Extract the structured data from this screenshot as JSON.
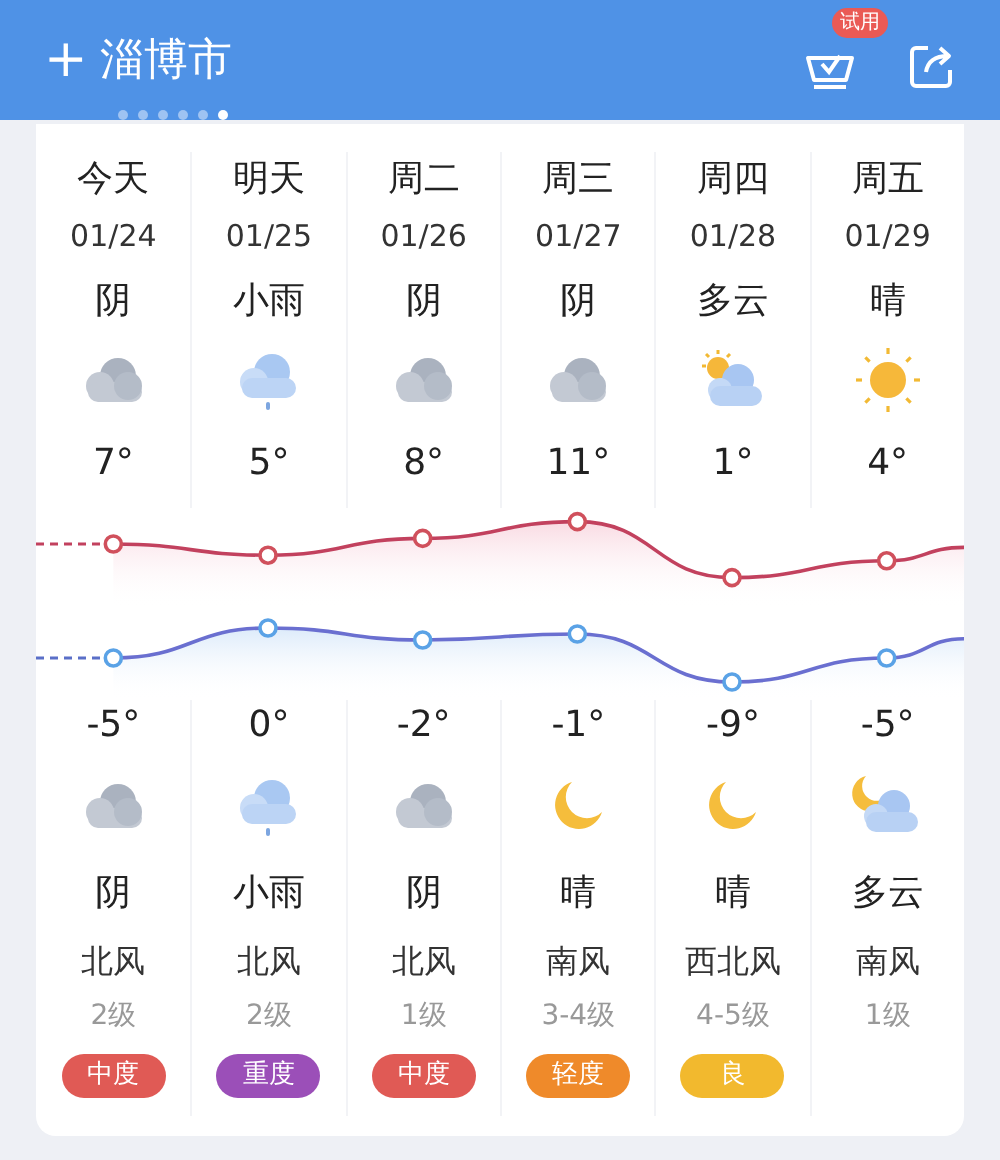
{
  "header": {
    "add_symbol": "+",
    "city": "淄博市",
    "page_dots": [
      {
        "selected": false
      },
      {
        "selected": false
      },
      {
        "selected": false
      },
      {
        "selected": false
      },
      {
        "selected": false
      },
      {
        "selected": true
      }
    ],
    "trial_badge": "试用"
  },
  "days": [
    {
      "day": "今天",
      "date": "01/24",
      "day_weather": "阴",
      "day_icon": {
        "kind": "cloudy"
      },
      "high": "7°",
      "low": "-5°",
      "night_icon": {
        "kind": "cloudy"
      },
      "night_weather": "阴",
      "wind": "北风",
      "wind_level": "2级",
      "aqi": {
        "label": "中度",
        "color": "#e05a55"
      }
    },
    {
      "day": "明天",
      "date": "01/25",
      "day_weather": "小雨",
      "day_icon": {
        "kind": "rain"
      },
      "high": "5°",
      "low": "0°",
      "night_icon": {
        "kind": "rain"
      },
      "night_weather": "小雨",
      "wind": "北风",
      "wind_level": "2级",
      "aqi": {
        "label": "重度",
        "color": "#9b4fb8"
      }
    },
    {
      "day": "周二",
      "date": "01/26",
      "day_weather": "阴",
      "day_icon": {
        "kind": "cloudy"
      },
      "high": "8°",
      "low": "-2°",
      "night_icon": {
        "kind": "cloudy"
      },
      "night_weather": "阴",
      "wind": "北风",
      "wind_level": "1级",
      "aqi": {
        "label": "中度",
        "color": "#e05a55"
      }
    },
    {
      "day": "周三",
      "date": "01/27",
      "day_weather": "阴",
      "day_icon": {
        "kind": "cloudy"
      },
      "high": "11°",
      "low": "-1°",
      "night_icon": {
        "kind": "moon"
      },
      "night_weather": "晴",
      "wind": "南风",
      "wind_level": "3-4级",
      "aqi": {
        "label": "轻度",
        "color": "#ef8a2a"
      }
    },
    {
      "day": "周四",
      "date": "01/28",
      "day_weather": "多云",
      "day_icon": {
        "kind": "partly"
      },
      "high": "1°",
      "low": "-9°",
      "night_icon": {
        "kind": "moon"
      },
      "night_weather": "晴",
      "wind": "西北风",
      "wind_level": "4-5级",
      "aqi": {
        "label": "良",
        "color": "#f2b92e"
      }
    },
    {
      "day": "周五",
      "date": "01/29",
      "day_weather": "晴",
      "day_icon": {
        "kind": "sunny"
      },
      "high": "4°",
      "low": "-5°",
      "night_icon": {
        "kind": "moon-cloud"
      },
      "night_weather": "多云",
      "wind": "南风",
      "wind_level": "1级"
    }
  ]
}
